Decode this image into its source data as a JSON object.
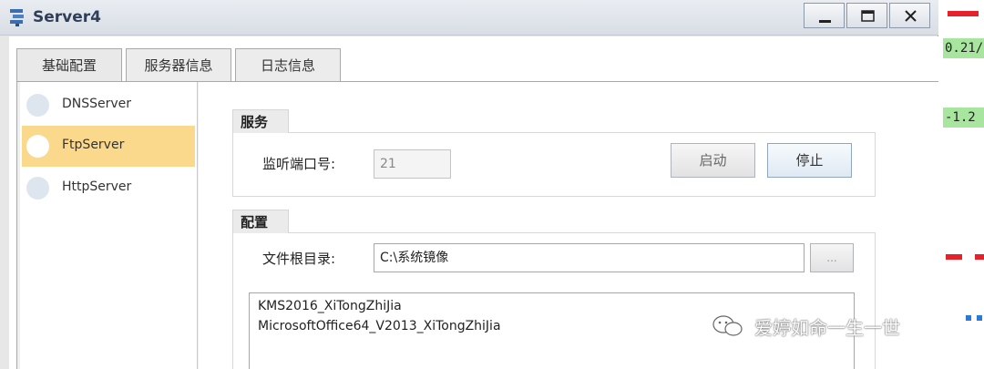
{
  "window": {
    "title": "Server4",
    "controls": {
      "minimize": "minimize",
      "maximize": "maximize",
      "close": "X"
    }
  },
  "tabs": [
    {
      "label": "基础配置",
      "active": true
    },
    {
      "label": "服务器信息",
      "active": false
    },
    {
      "label": "日志信息",
      "active": false
    }
  ],
  "servers": [
    {
      "label": "DNSServer",
      "selected": false
    },
    {
      "label": "FtpServer",
      "selected": true
    },
    {
      "label": "HttpServer",
      "selected": false
    }
  ],
  "service": {
    "heading": "服务",
    "port_label": "监听端口号:",
    "port_value": "21",
    "start_label": "启动",
    "stop_label": "停止"
  },
  "config": {
    "heading": "配置",
    "root_label": "文件根目录:",
    "root_value": "C:\\系统镜像",
    "browse_label": "...",
    "files": [
      "KMS2016_XiTongZhiJia",
      "MicrosoftOffice64_V2013_XiTongZhiJia"
    ]
  },
  "watermark": {
    "text": "爱婷如命一生一世"
  },
  "background": {
    "ip_text_1": "0.21/",
    "ip_text_2": "-1.2"
  },
  "colors": {
    "selected_row": "#fbd98c",
    "title_text": "#2f3f59",
    "link_red": "#e8202a",
    "link_green": "#a8e6a0"
  }
}
